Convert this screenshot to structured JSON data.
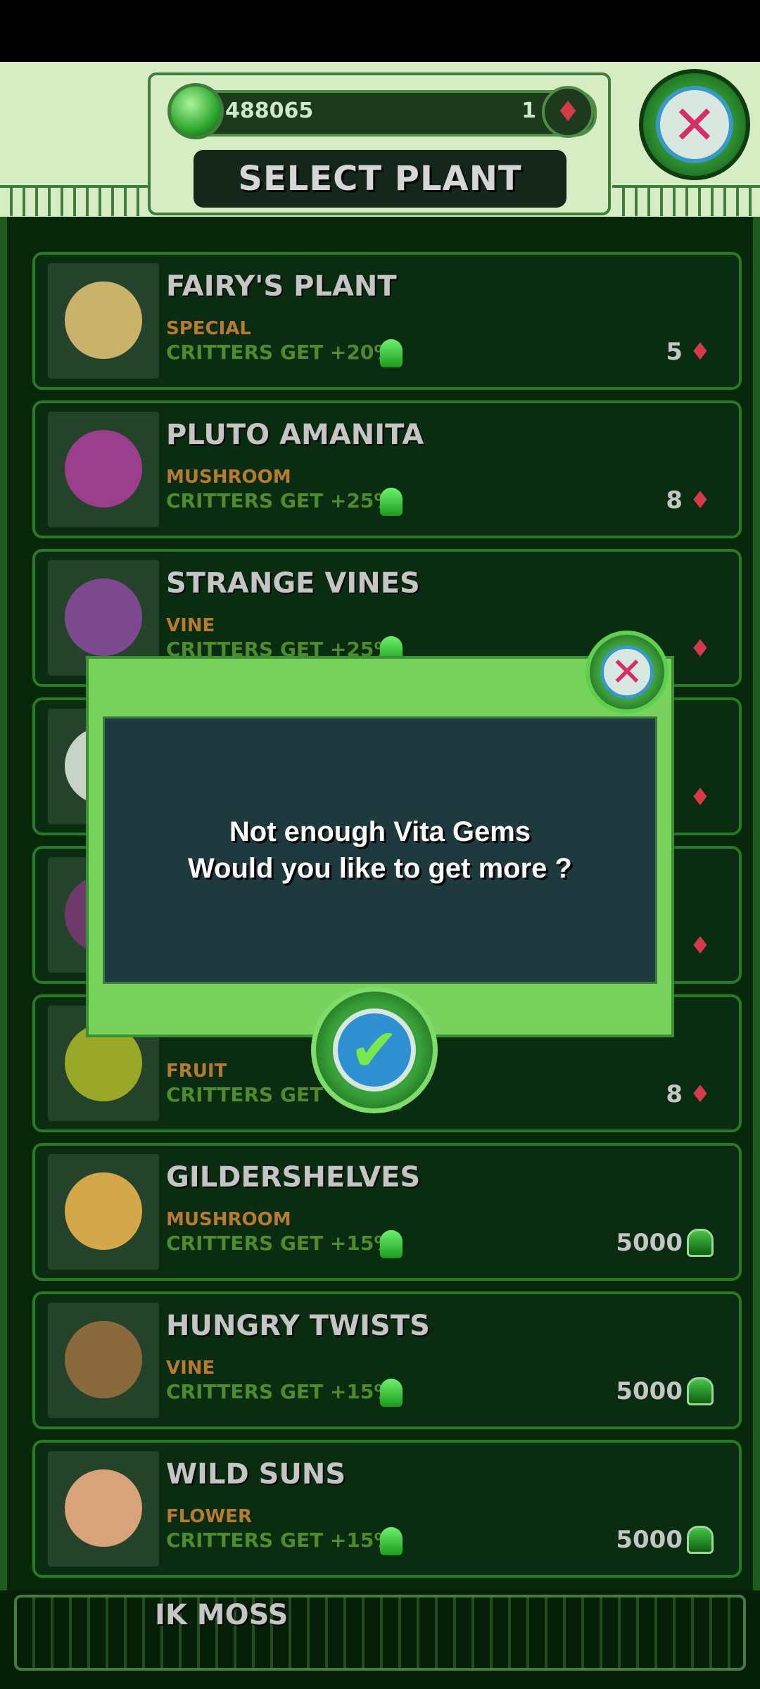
{
  "header": {
    "green_gems": "488065",
    "red_gems": "1",
    "title": "SELECT PLANT",
    "icons": {
      "green_gem": "vita-gem-green-icon",
      "red_gem": "red-gem-icon",
      "close": "close-icon"
    }
  },
  "plants": [
    {
      "name": "FAIRY'S PLANT",
      "category": "SPECIAL",
      "bonus": "CRITTERS GET +20%",
      "price": "5",
      "currency": "red"
    },
    {
      "name": "PLUTO AMANITA",
      "category": "MUSHROOM",
      "bonus": "CRITTERS GET +25%",
      "price": "8",
      "currency": "red"
    },
    {
      "name": "STRANGE VINES",
      "category": "VINE",
      "bonus": "CRITTERS GET +25%",
      "price": "",
      "currency": "red"
    },
    {
      "name": "",
      "category": "",
      "bonus": "",
      "price": "",
      "currency": "red"
    },
    {
      "name": "",
      "category": "",
      "bonus": "",
      "price": "",
      "currency": "red"
    },
    {
      "name": "",
      "category": "FRUIT",
      "bonus": "CRITTERS GET +25%",
      "price": "8",
      "currency": "red"
    },
    {
      "name": "GILDERSHELVES",
      "category": "MUSHROOM",
      "bonus": "CRITTERS GET +15%",
      "price": "5000",
      "currency": "green"
    },
    {
      "name": "HUNGRY TWISTS",
      "category": "VINE",
      "bonus": "CRITTERS GET +15%",
      "price": "5000",
      "currency": "green"
    },
    {
      "name": "WILD SUNS",
      "category": "FLOWER",
      "bonus": "CRITTERS GET +15%",
      "price": "5000",
      "currency": "green"
    }
  ],
  "footer": {
    "partial_name": "IK MOSS"
  },
  "modal": {
    "line1": "Not enough Vita Gems",
    "line2": "Would you like to get more ?",
    "confirm_icon": "checkmark-icon",
    "close_icon": "close-icon"
  }
}
